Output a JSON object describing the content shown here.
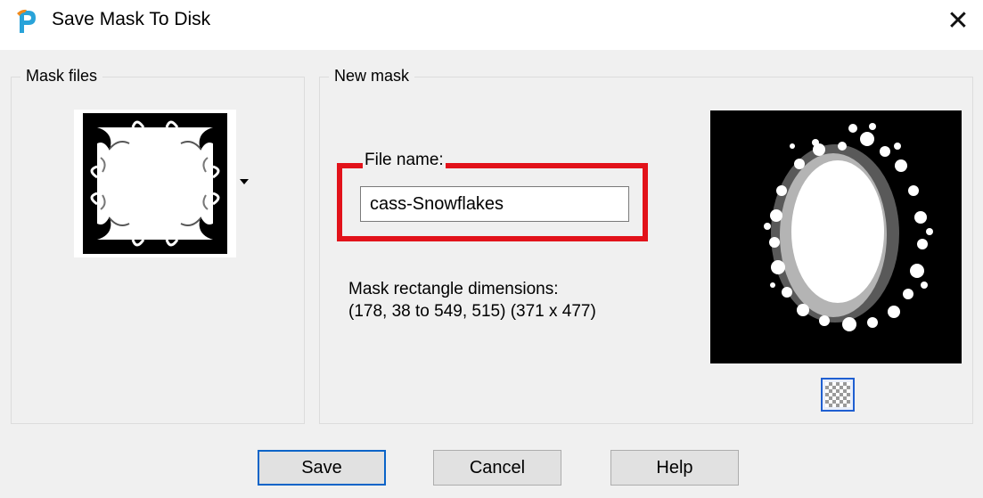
{
  "window": {
    "title": "Save Mask To Disk",
    "close_glyph": "✕",
    "app_icon": "paintshop-pro-icon"
  },
  "mask_files": {
    "legend": "Mask files",
    "thumbnail": "ornate-frame-mask-thumbnail"
  },
  "new_mask": {
    "legend": "New mask",
    "file_name_label": "File name:",
    "file_name_value": "cass-Snowflakes",
    "dims_label": "Mask rectangle dimensions:",
    "dims_value": "(178, 38 to 549, 515) (371 x 477)",
    "preview": "snowflake-oval-mask-preview",
    "transparency_icon": "checkerboard-icon"
  },
  "buttons": {
    "save": "Save",
    "cancel": "Cancel",
    "help": "Help"
  },
  "colors": {
    "highlight_box": "#e2121a",
    "default_button_border": "#0a64c8",
    "preview_bg": "#000000"
  }
}
